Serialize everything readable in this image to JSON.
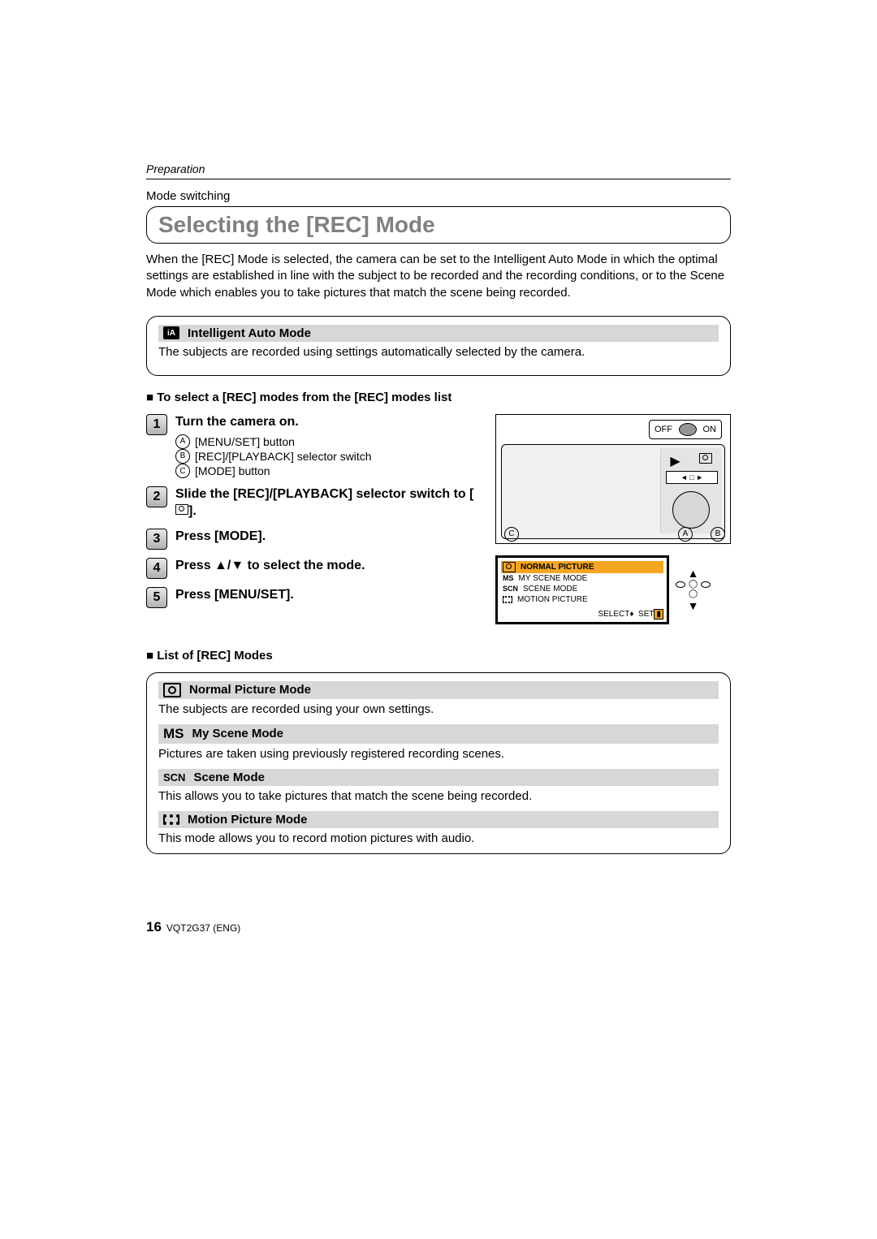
{
  "section_label": "Preparation",
  "subheader": "Mode switching",
  "title": "Selecting the [REC] Mode",
  "intro": "When the [REC] Mode is selected, the camera can be set to the Intelligent Auto Mode in which the optimal settings are established in line with the subject to be recorded and the recording conditions, or to the Scene Mode which enables you to take pictures that match the scene being recorded.",
  "ia_mode": {
    "title": "Intelligent Auto Mode",
    "desc": "The subjects are recorded using settings automatically selected by the camera."
  },
  "select_heading": "To select a [REC] modes from the [REC] modes list",
  "steps": [
    {
      "num": "1",
      "title": "Turn the camera on.",
      "items": [
        {
          "letter": "A",
          "text": "[MENU/SET] button"
        },
        {
          "letter": "B",
          "text": "[REC]/[PLAYBACK] selector switch"
        },
        {
          "letter": "C",
          "text": "[MODE] button"
        }
      ]
    },
    {
      "num": "2",
      "title": "Slide the [REC]/[PLAYBACK] selector switch to [",
      "title_suffix": "]."
    },
    {
      "num": "3",
      "title": "Press [MODE]."
    },
    {
      "num": "4",
      "title": "Press ▲/▼ to select the mode."
    },
    {
      "num": "5",
      "title": "Press [MENU/SET]."
    }
  ],
  "onoff": {
    "off": "OFF",
    "on": "ON"
  },
  "callouts": {
    "a": "A",
    "b": "B",
    "c": "C"
  },
  "menu_items": [
    {
      "icon": "cam",
      "label": "NORMAL PICTURE",
      "highlight": true
    },
    {
      "icon": "ms",
      "label": "MY SCENE MODE"
    },
    {
      "icon": "scn",
      "label": "SCENE MODE"
    },
    {
      "icon": "film",
      "label": "MOTION PICTURE"
    }
  ],
  "menu_footer_select": "SELECT",
  "menu_footer_set": "SET",
  "list_heading": "List of [REC] Modes",
  "modes_list": [
    {
      "icon": "cam",
      "title": "Normal Picture Mode",
      "desc": "The subjects are recorded using your own settings."
    },
    {
      "icon": "ms",
      "title": "My Scene Mode",
      "desc": "Pictures are taken using previously registered recording scenes."
    },
    {
      "icon": "scn",
      "title": "Scene Mode",
      "desc": "This allows you to take pictures that match the scene being recorded."
    },
    {
      "icon": "film",
      "title": "Motion Picture Mode",
      "desc": "This mode allows you to record motion pictures with audio."
    }
  ],
  "footer": {
    "page": "16",
    "code": "VQT2G37 (ENG)"
  }
}
